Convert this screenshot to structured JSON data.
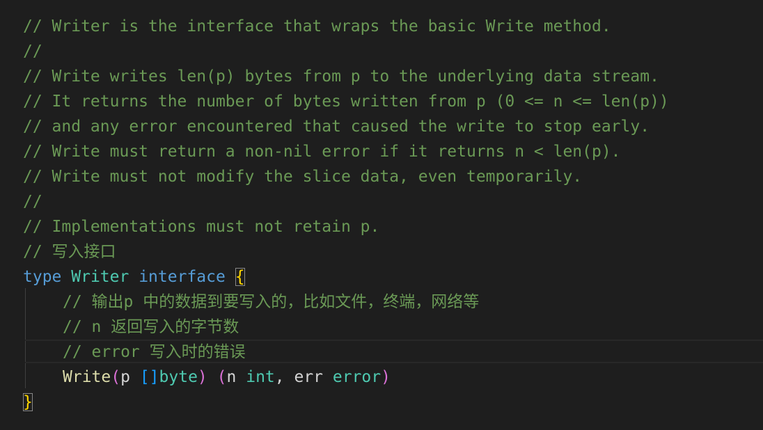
{
  "editor": {
    "language": "go",
    "lines": [
      "// Writer is the interface that wraps the basic Write method.",
      "//",
      "// Write writes len(p) bytes from p to the underlying data stream.",
      "// It returns the number of bytes written from p (0 <= n <= len(p))",
      "// and any error encountered that caused the write to stop early.",
      "// Write must return a non-nil error if it returns n < len(p).",
      "// Write must not modify the slice data, even temporarily.",
      "//",
      "// Implementations must not retain p.",
      "// 写入接口"
    ],
    "type_decl": {
      "keyword": "type",
      "name": "Writer",
      "kind": "interface",
      "open_brace": "{",
      "close_brace": "}"
    },
    "inner_comments": [
      "// 输出p 中的数据到要写入的，比如文件，终端，网络等",
      "// n 返回写入的字节数",
      "// error 写入时的错误"
    ],
    "method": {
      "name": "Write",
      "lparen1": "(",
      "param": "p",
      "slice": "[]",
      "param_type": "byte",
      "rparen1": ")",
      "lparen2": "(",
      "ret1": "n",
      "ret1_type": "int",
      "comma": ",",
      "ret2": "err",
      "ret2_type": "error",
      "rparen2": ")"
    },
    "colors": {
      "background": "#1e1e1e",
      "comment": "#6a9955",
      "keyword": "#569cd6",
      "type": "#4ec9b0",
      "function": "#dcdcaa",
      "bracket_gold": "#ffd700",
      "bracket_purple": "#da70d6",
      "bracket_blue": "#179fff"
    }
  }
}
